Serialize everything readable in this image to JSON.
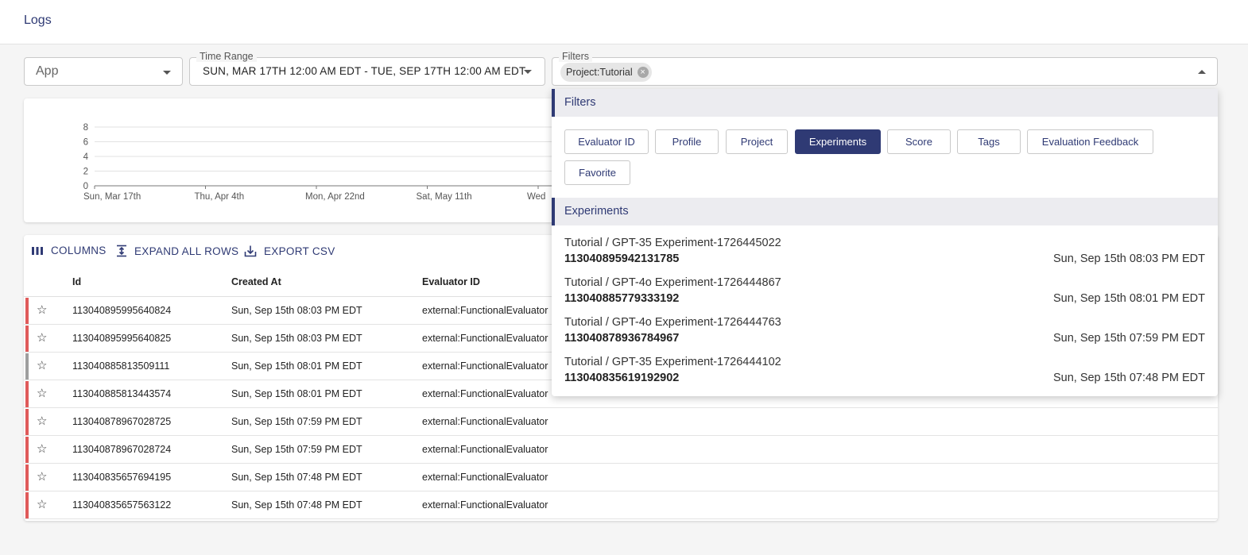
{
  "header": {
    "title": "Logs"
  },
  "app_select": {
    "placeholder": "App"
  },
  "time_range": {
    "label": "Time Range",
    "value": "SUN, MAR 17TH 12:00 AM EDT - TUE, SEP 17TH 12:00 AM EDT"
  },
  "filters_field": {
    "label": "Filters",
    "chip": "Project:Tutorial"
  },
  "chart_data": {
    "type": "line",
    "y_ticks": [
      "0",
      "2",
      "4",
      "6",
      "8"
    ],
    "x_ticks": [
      "Sun, Mar 17th",
      "Thu, Apr 4th",
      "Mon, Apr 22nd",
      "Sat, May 11th",
      "Wed"
    ],
    "ylim": [
      0,
      8
    ],
    "grid": true
  },
  "toolbar": {
    "columns": "COLUMNS",
    "expand": "EXPAND ALL ROWS",
    "export": "EXPORT CSV"
  },
  "table": {
    "columns": [
      "Id",
      "Created At",
      "Evaluator ID"
    ],
    "rows": [
      {
        "id": "113040895995640824",
        "created": "Sun, Sep 15th 08:03 PM EDT",
        "evaluator": "external:FunctionalEvaluator",
        "status_color": "#e05a5a"
      },
      {
        "id": "113040895995640825",
        "created": "Sun, Sep 15th 08:03 PM EDT",
        "evaluator": "external:FunctionalEvaluator",
        "status_color": "#e05a5a"
      },
      {
        "id": "113040885813509111",
        "created": "Sun, Sep 15th 08:01 PM EDT",
        "evaluator": "external:FunctionalEvaluator",
        "status_color": "#9e9e9e"
      },
      {
        "id": "113040885813443574",
        "created": "Sun, Sep 15th 08:01 PM EDT",
        "evaluator": "external:FunctionalEvaluator",
        "status_color": "#e05a5a"
      },
      {
        "id": "113040878967028725",
        "created": "Sun, Sep 15th 07:59 PM EDT",
        "evaluator": "external:FunctionalEvaluator",
        "status_color": "#e05a5a"
      },
      {
        "id": "113040878967028724",
        "created": "Sun, Sep 15th 07:59 PM EDT",
        "evaluator": "external:FunctionalEvaluator",
        "status_color": "#e05a5a"
      },
      {
        "id": "113040835657694195",
        "created": "Sun, Sep 15th 07:48 PM EDT",
        "evaluator": "external:FunctionalEvaluator",
        "status_color": "#e05a5a"
      },
      {
        "id": "113040835657563122",
        "created": "Sun, Sep 15th 07:48 PM EDT",
        "evaluator": "external:FunctionalEvaluator",
        "status_color": "#e05a5a"
      }
    ]
  },
  "dropdown": {
    "filters_header": "Filters",
    "filter_buttons": [
      "Evaluator ID",
      "Profile",
      "Project",
      "Experiments",
      "Score",
      "Tags",
      "Evaluation Feedback",
      "Favorite"
    ],
    "active_filter": "Experiments",
    "experiments_header": "Experiments",
    "experiments": [
      {
        "name": "Tutorial / GPT-35 Experiment-1726445022",
        "id": "113040895942131785",
        "date": "Sun, Sep 15th 08:03 PM EDT"
      },
      {
        "name": "Tutorial / GPT-4o Experiment-1726444867",
        "id": "113040885779333192",
        "date": "Sun, Sep 15th 08:01 PM EDT"
      },
      {
        "name": "Tutorial / GPT-4o Experiment-1726444763",
        "id": "113040878936784967",
        "date": "Sun, Sep 15th 07:59 PM EDT"
      },
      {
        "name": "Tutorial / GPT-35 Experiment-1726444102",
        "id": "113040835619192902",
        "date": "Sun, Sep 15th 07:48 PM EDT"
      }
    ]
  }
}
